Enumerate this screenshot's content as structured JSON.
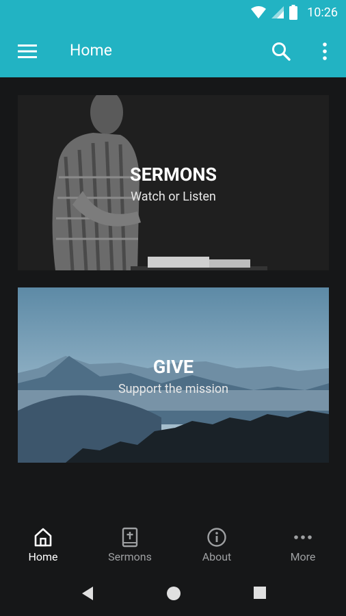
{
  "statusbar": {
    "time": "10:26"
  },
  "appbar": {
    "title": "Home"
  },
  "cards": [
    {
      "title": "SERMONS",
      "subtitle": "Watch or Listen"
    },
    {
      "title": "GIVE",
      "subtitle": "Support the mission"
    }
  ],
  "bottom_nav": {
    "items": [
      {
        "label": "Home",
        "icon": "home-icon",
        "active": true
      },
      {
        "label": "Sermons",
        "icon": "bible-icon",
        "active": false
      },
      {
        "label": "About",
        "icon": "info-icon",
        "active": false
      },
      {
        "label": "More",
        "icon": "more-horizontal-icon",
        "active": false
      }
    ]
  },
  "colors": {
    "accent": "#22b3c3",
    "background": "#161718",
    "inactive_label": "#9ea0a2"
  }
}
